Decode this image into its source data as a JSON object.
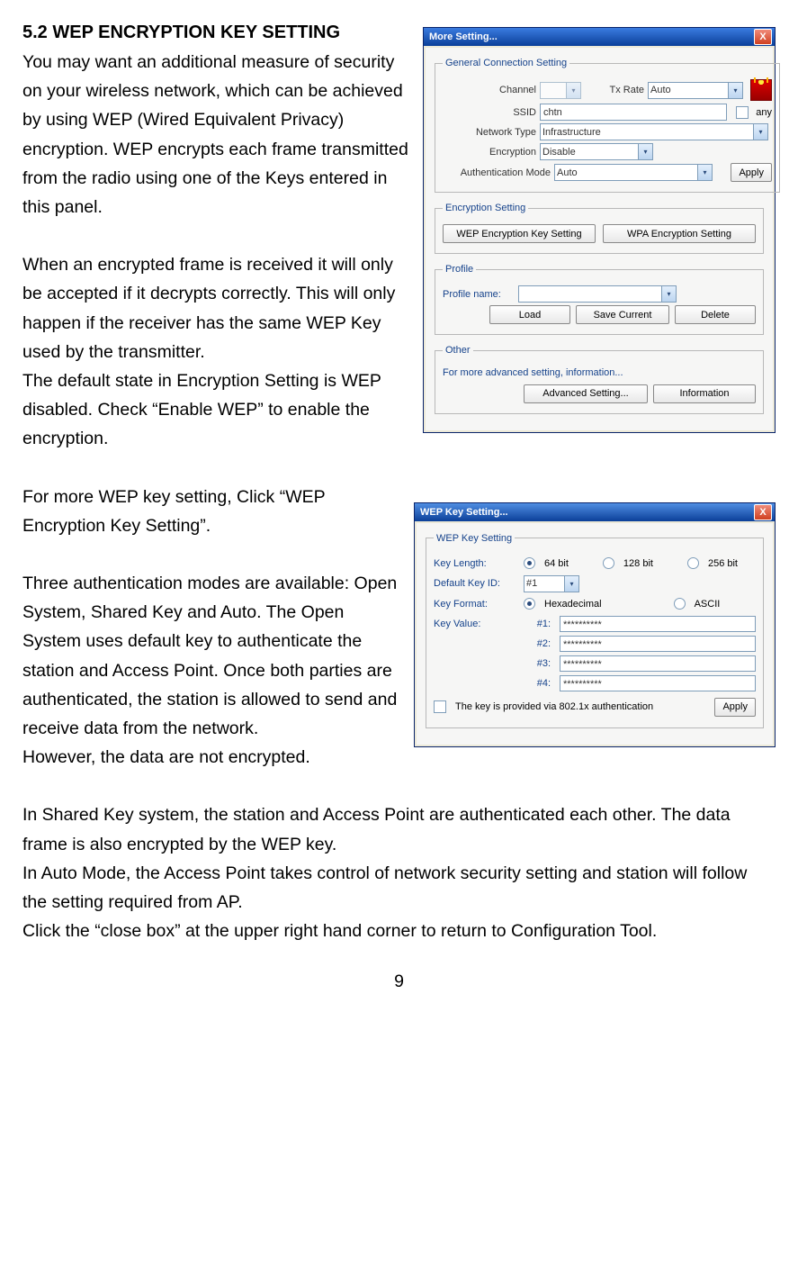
{
  "heading": "5.2 WEP ENCRYPTION KEY SETTING",
  "para1": "You may want an additional measure of security on your wireless network, which can be achieved by using WEP (Wired Equivalent Privacy) encryption. WEP encrypts each frame transmitted from the radio using one of the Keys entered in this panel.",
  "para2": "When an encrypted frame is received it will only be accepted if it decrypts correctly. This will only happen if the receiver has the same WEP Key used by the transmitter.",
  "para3": "The default state in Encryption Setting is WEP disabled. Check “Enable WEP” to enable the encryption.",
  "para4": "For more WEP key setting, Click “WEP Encryption Key Setting”.",
  "para5": "Three authentication modes are available: Open System, Shared Key and Auto. The Open System uses default key to authenticate the station and Access Point. Once both parties are authenticated, the station is allowed to send and receive data from the network.",
  "para6": "However, the data are not encrypted.",
  "para7": "In Shared Key system, the station and Access Point are authenticated each other. The data frame is also encrypted by the WEP key.",
  "para8": "In Auto Mode, the Access Point takes control of network security setting and station will follow the setting required from AP.",
  "para9": "Click the “close box” at the upper right hand corner to return to Configuration Tool.",
  "pagenum": "9",
  "more_setting": {
    "title": "More Setting...",
    "close": "X",
    "general": {
      "legend": "General Connection Setting",
      "channel_label": "Channel",
      "txrate_label": "Tx Rate",
      "txrate_value": "Auto",
      "ssid_label": "SSID",
      "ssid_value": "chtn",
      "any_label": "any",
      "nettype_label": "Network Type",
      "nettype_value": "Infrastructure",
      "encryption_label": "Encryption",
      "encryption_value": "Disable",
      "authmode_label": "Authentication Mode",
      "authmode_value": "Auto",
      "apply": "Apply"
    },
    "enc": {
      "legend": "Encryption Setting",
      "wep_btn": "WEP Encryption Key Setting",
      "wpa_btn": "WPA Encryption Setting"
    },
    "profile": {
      "legend": "Profile",
      "name_label": "Profile name:",
      "load": "Load",
      "save": "Save Current",
      "delete": "Delete"
    },
    "other": {
      "legend": "Other",
      "text": "For more advanced setting, information...",
      "adv": "Advanced Setting...",
      "info": "Information"
    }
  },
  "wep": {
    "title": "WEP Key Setting...",
    "close": "X",
    "legend": "WEP Key Setting",
    "keylen_label": "Key Length:",
    "len64": "64 bit",
    "len128": "128 bit",
    "len256": "256 bit",
    "defid_label": "Default Key ID:",
    "defid_value": "#1",
    "format_label": "Key Format:",
    "hex": "Hexadecimal",
    "ascii": "ASCII",
    "value_label": "Key Value:",
    "k1": "#1:",
    "k2": "#2:",
    "k3": "#3:",
    "k4": "#4:",
    "mask": "**********",
    "auth_label": "The key is provided via 802.1x authentication",
    "apply": "Apply"
  }
}
